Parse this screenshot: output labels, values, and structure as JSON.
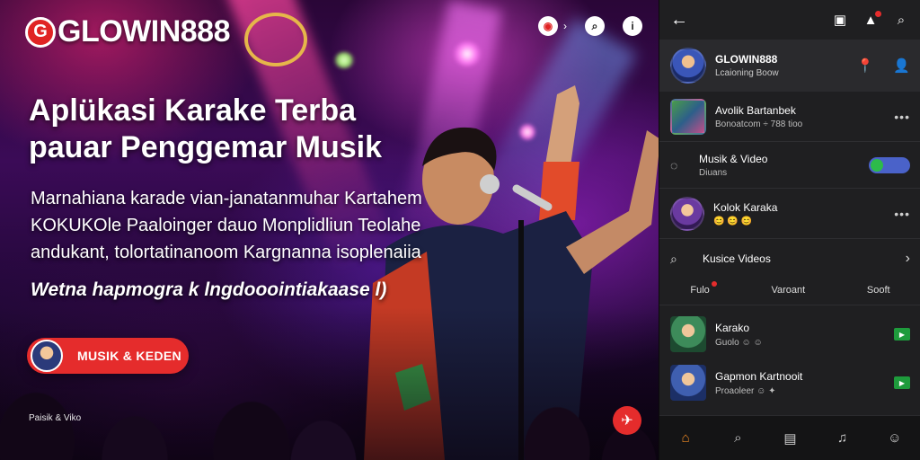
{
  "hero": {
    "logo_mark": "G",
    "logo_text": "GLOWIN888",
    "headline": "Aplükasi Karake Terba\npauar Penggemar Musik",
    "body": "Marnahiana karade vian-janatanmuhar Kartahem\nKOKUKOle Paaloinger dauo Monplidliun Teolahe\n andukant, tolortatinanoom Kargnanna isoplenaiia",
    "tagline": "Wetna hapmogra k lngdooointiakaase l)",
    "cta_label": "MUSIK & KEDEN",
    "footnote": "Paisik & Viko"
  },
  "panel": {
    "profile": {
      "name": "GLOWIN888",
      "sub": "Lcaioning Boow"
    },
    "items": [
      {
        "title": "Avolik Bartanbek",
        "sub": "Bonoatcom  ÷ 788 tioo"
      },
      {
        "title": "Musik & Video",
        "sub": "Diuans"
      },
      {
        "title": "Kolok Karaka",
        "sub": "😊 😊 😊"
      }
    ],
    "search_label": "Kusice Videos",
    "tabs": [
      "Fulo",
      "Varoant",
      "Sooft"
    ],
    "videos": [
      {
        "title": "Karako",
        "sub": "Guolo ☺ ☺"
      },
      {
        "title": "Gapmon Kartnooit",
        "sub": "Proaoleer ☺ ✦"
      }
    ]
  },
  "colors": {
    "accent_red": "#e52c2c",
    "accent_green": "#2dbb4a",
    "toggle_blue": "#4a62c9",
    "nav_active": "#f08a24",
    "panel_bg": "#1f1f21"
  },
  "icons": {
    "top_left_logo": "g-logo-icon",
    "hero_top": [
      "target-icon",
      "search-icon",
      "info-icon"
    ],
    "panel_top": [
      "back-arrow-icon",
      "apps-icon",
      "bell-icon",
      "search-icon"
    ],
    "nav": [
      "home-icon",
      "explore-icon",
      "library-icon",
      "karaoke-icon",
      "profile-icon"
    ]
  }
}
